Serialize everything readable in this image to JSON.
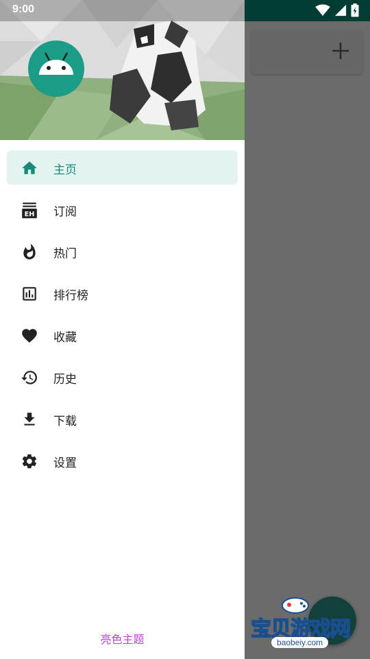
{
  "status_bar": {
    "time": "9:00"
  },
  "drawer": {
    "menu": [
      {
        "label": "主页",
        "icon": "home-icon",
        "active": true
      },
      {
        "label": "订阅",
        "icon": "subscription-eh-icon",
        "active": false
      },
      {
        "label": "热门",
        "icon": "fire-icon",
        "active": false
      },
      {
        "label": "排行榜",
        "icon": "chart-icon",
        "active": false
      },
      {
        "label": "收藏",
        "icon": "heart-icon",
        "active": false
      },
      {
        "label": "历史",
        "icon": "history-icon",
        "active": false
      },
      {
        "label": "下载",
        "icon": "download-icon",
        "active": false
      },
      {
        "label": "设置",
        "icon": "gear-icon",
        "active": false
      }
    ],
    "theme_toggle": "亮色主题"
  },
  "watermark": {
    "title": "宝贝游戏网",
    "url": "baobeiy.com"
  },
  "colors": {
    "accent": "#1a8a78",
    "active_bg": "#e3f3f0",
    "theme_text": "#b545c8",
    "avatar": "#1a9c86"
  }
}
